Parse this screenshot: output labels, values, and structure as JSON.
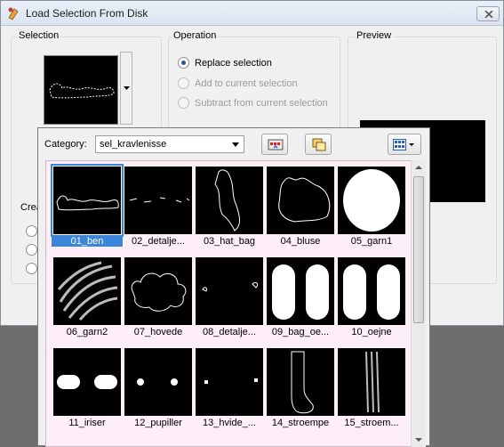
{
  "window": {
    "title": "Load Selection From Disk",
    "close_icon": "close-x"
  },
  "selection_group": {
    "title": "Selection"
  },
  "operation_group": {
    "title": "Operation",
    "options": [
      {
        "label": "Replace selection",
        "checked": true,
        "enabled": true
      },
      {
        "label": "Add to current selection",
        "checked": false,
        "enabled": false
      },
      {
        "label": "Subtract from current selection",
        "checked": false,
        "enabled": false
      }
    ]
  },
  "preview_group": {
    "title": "Preview"
  },
  "create_group": {
    "title": "Crea"
  },
  "popup": {
    "category_label": "Category:",
    "category_value": "sel_kravlenisse",
    "toolbar_icons": [
      "folder-settings-icon",
      "copy-icon",
      "view-mode-icon"
    ],
    "items": [
      {
        "label": "01_ben",
        "selected": true
      },
      {
        "label": "02_detalje..."
      },
      {
        "label": "03_hat_bag"
      },
      {
        "label": "04_bluse"
      },
      {
        "label": "05_garn1"
      },
      {
        "label": "06_garn2"
      },
      {
        "label": "07_hovede"
      },
      {
        "label": "08_detalje..."
      },
      {
        "label": "09_bag_oe..."
      },
      {
        "label": "10_oejne"
      },
      {
        "label": "11_iriser"
      },
      {
        "label": "12_pupiller"
      },
      {
        "label": "13_hvide_..."
      },
      {
        "label": "14_stroempe"
      },
      {
        "label": "15_stroem..."
      }
    ]
  },
  "colors": {
    "selection_highlight": "#3a86d8",
    "gallery_bg": "#fdeef7"
  }
}
